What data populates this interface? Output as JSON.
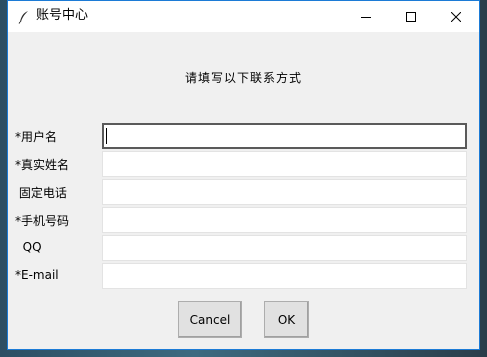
{
  "window": {
    "title": "账号中心",
    "icon": "feather-icon",
    "controls": [
      "minimize-icon",
      "maximize-icon",
      "close-icon"
    ]
  },
  "form": {
    "heading": "请填写以下联系方式",
    "fields": [
      {
        "label": "*用户名",
        "value": "",
        "focused": true
      },
      {
        "label": "*真实姓名",
        "value": ""
      },
      {
        "label": " 固定电话",
        "value": ""
      },
      {
        "label": "*手机号码",
        "value": ""
      },
      {
        "label": "  QQ",
        "value": ""
      },
      {
        "label": "*E-mail",
        "value": ""
      }
    ]
  },
  "buttons": {
    "cancel": "Cancel",
    "ok": "OK"
  },
  "colors": {
    "window_border": "#1c7bd6",
    "window_bg": "#f0f0f0",
    "input_focus_border": "#5a5a5a"
  }
}
